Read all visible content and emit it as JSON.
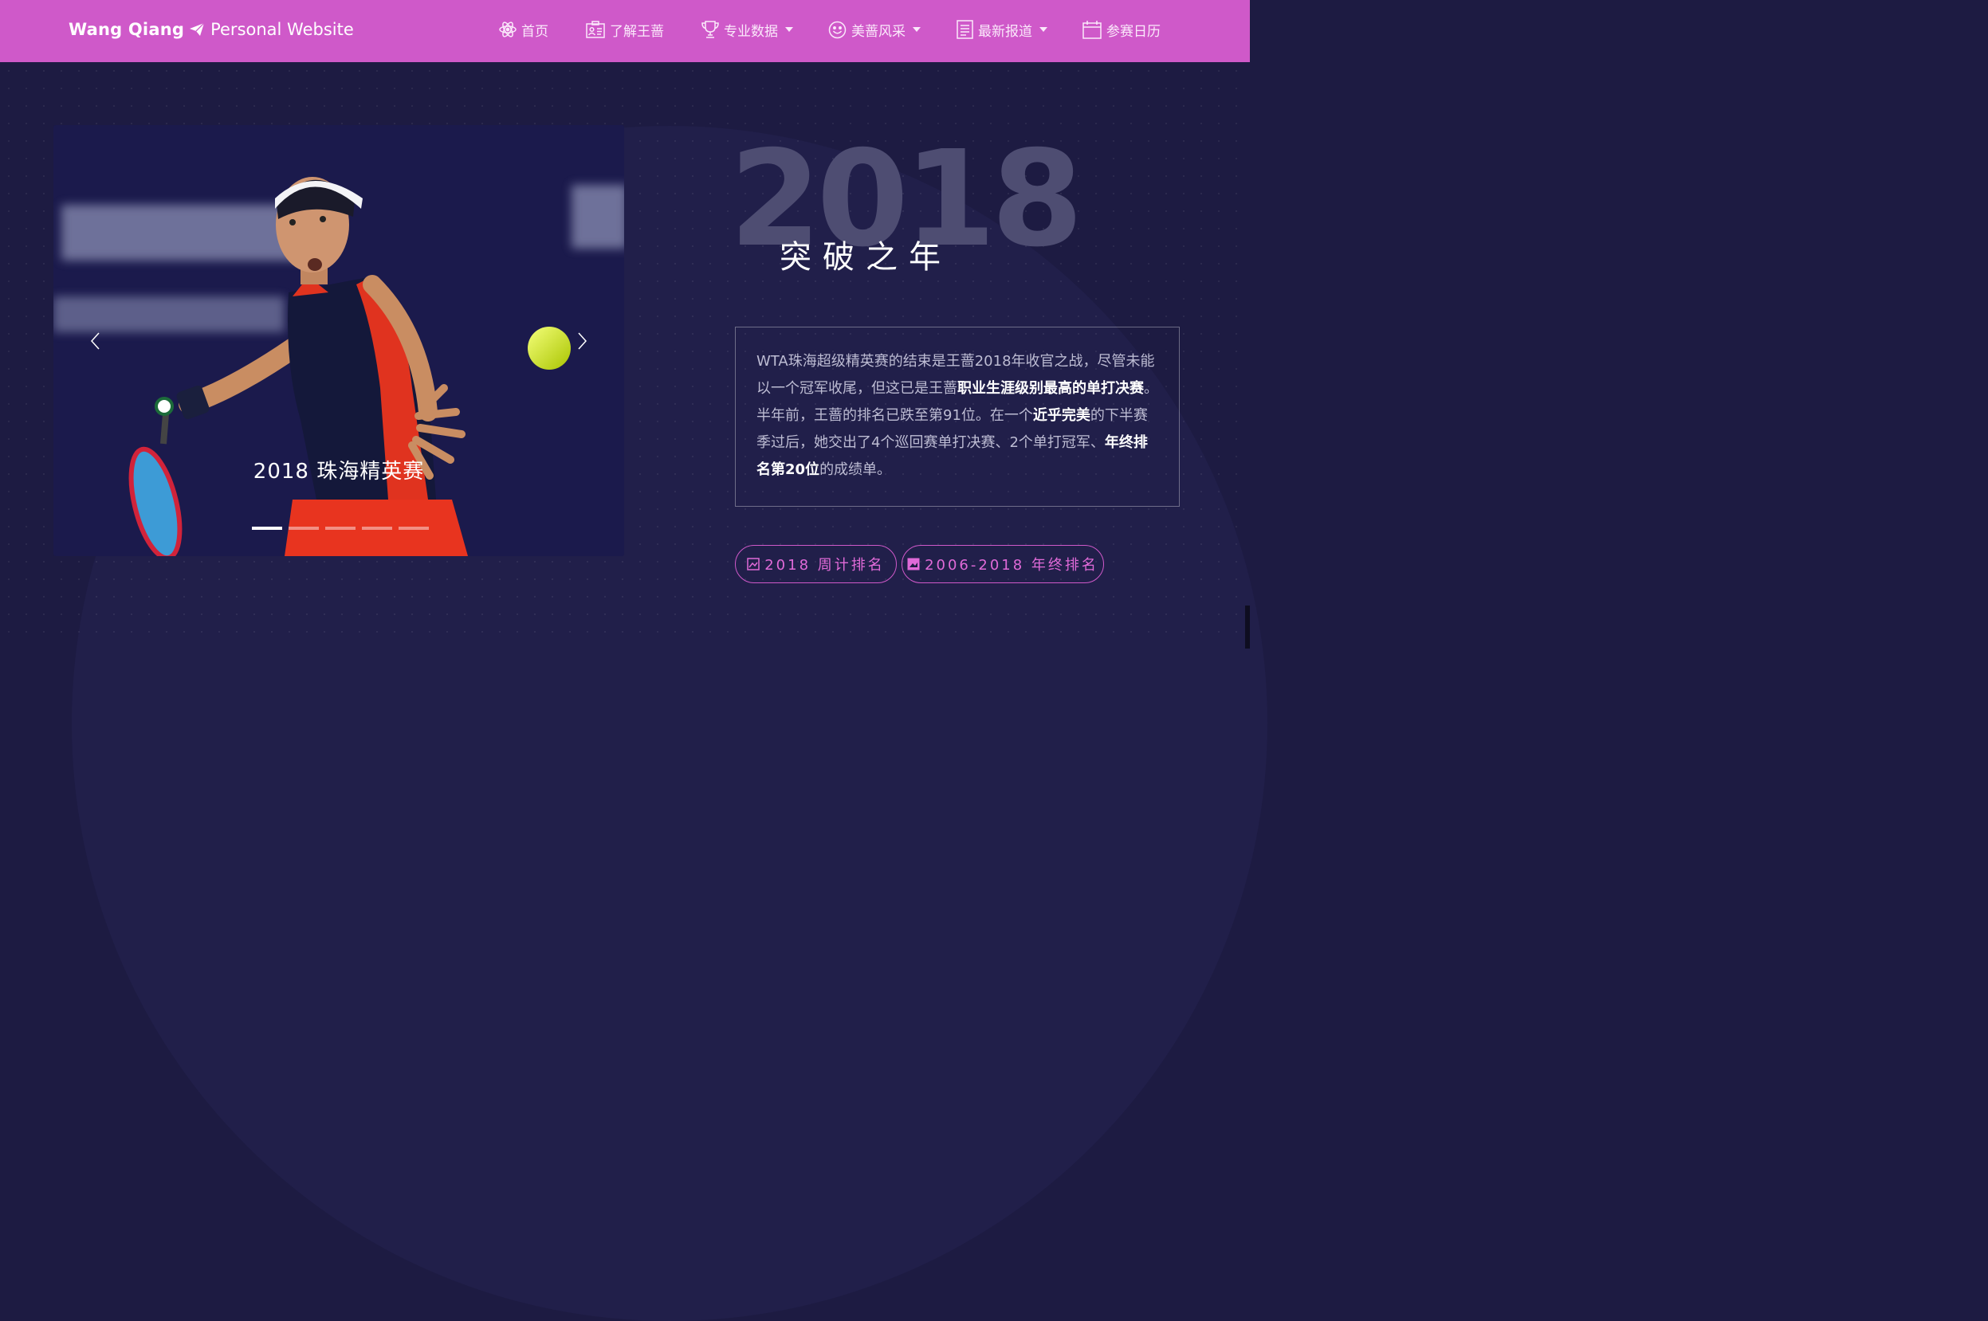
{
  "navbar": {
    "brand_bold": "Wang Qiang",
    "brand_light": "Personal Website",
    "items": [
      {
        "label": "首页",
        "icon": "atom-icon",
        "dropdown": false
      },
      {
        "label": "了解王蔷",
        "icon": "id-card-icon",
        "dropdown": false
      },
      {
        "label": "专业数据",
        "icon": "trophy-icon",
        "dropdown": true
      },
      {
        "label": "美蔷风采",
        "icon": "smile-icon",
        "dropdown": true
      },
      {
        "label": "最新报道",
        "icon": "document-icon",
        "dropdown": true
      },
      {
        "label": "参赛日历",
        "icon": "calendar-icon",
        "dropdown": false
      }
    ]
  },
  "carousel": {
    "caption": "2018 珠海精英赛",
    "slide_count": 5,
    "active_index": 0
  },
  "hero": {
    "year": "2018",
    "subtitle": "突破之年"
  },
  "info": {
    "parts": [
      {
        "text": "WTA珠海超级精英赛的结束是王蔷2018年收官之战，尽管未能以一个冠军收尾，但这已是王蔷",
        "bold": false
      },
      {
        "text": "职业生涯级别最高的单打决赛",
        "bold": true
      },
      {
        "text": "。半年前，王蔷的排名已跌至第91位。在一个",
        "bold": false
      },
      {
        "text": "近乎完美",
        "bold": true
      },
      {
        "text": "的下半赛季过后，她交出了4个巡回赛单打决赛、2个单打冠军、",
        "bold": false
      },
      {
        "text": "年终排名第20位",
        "bold": true
      },
      {
        "text": "的成绩单。",
        "bold": false
      }
    ]
  },
  "buttons": [
    {
      "label": "2018 周计排名",
      "icon": "image-icon"
    },
    {
      "label": "2006-2018 年终排名",
      "icon": "image-icon"
    }
  ],
  "colors": {
    "navbar": "#cf59c9",
    "background": "#1d1b42",
    "accent": "#e06ad8"
  }
}
